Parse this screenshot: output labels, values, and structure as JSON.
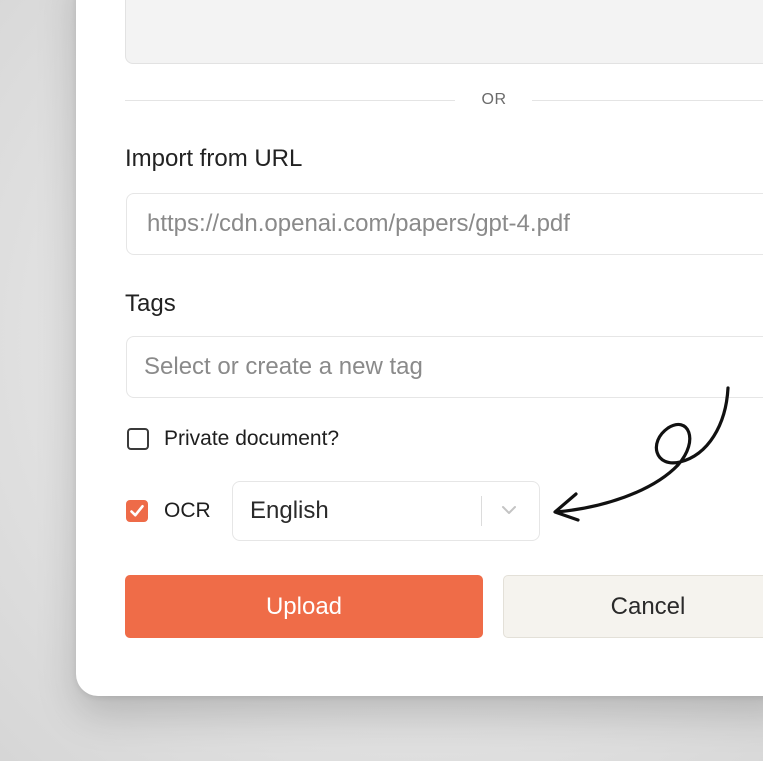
{
  "divider": {
    "or_label": "OR"
  },
  "import_url": {
    "label": "Import from URL",
    "placeholder": "https://cdn.openai.com/papers/gpt-4.pdf"
  },
  "tags": {
    "label": "Tags",
    "placeholder": "Select or create a new tag"
  },
  "private_document": {
    "label": "Private document?",
    "checked": false
  },
  "ocr": {
    "label": "OCR",
    "checked": true,
    "language": "English"
  },
  "actions": {
    "upload_label": "Upload",
    "cancel_label": "Cancel"
  },
  "colors": {
    "accent": "#ef6c48",
    "cancel_bg": "#f5f3ee"
  },
  "icons": {
    "checkbox_checked": "check-icon",
    "select_dropdown": "chevron-down-icon",
    "annotation": "curly-arrow-icon"
  }
}
